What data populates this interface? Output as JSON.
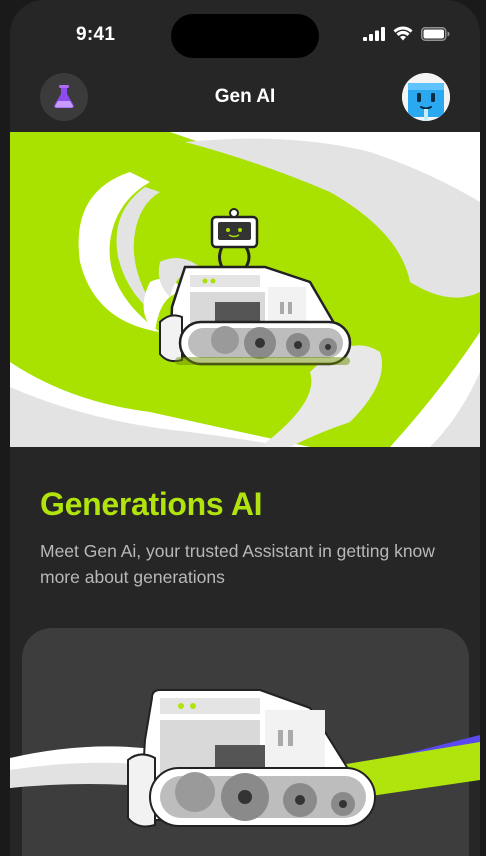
{
  "status_bar": {
    "time": "9:41",
    "icons": [
      "cellular-signal-icon",
      "wifi-icon",
      "battery-icon"
    ]
  },
  "nav": {
    "title": "Gen AI",
    "left_icon": "flask-icon",
    "right_avatar": "robot-avatar"
  },
  "hero": {
    "illustration": "robot-bulldozer-illustration"
  },
  "content": {
    "heading": "Generations AI",
    "description": "Meet Gen Ai, your trusted Assistant in getting know more about generations"
  },
  "card": {
    "illustration": "bulldozer-illustration"
  },
  "colors": {
    "accent": "#b0e40c",
    "hero_bg": "#a9e100",
    "screen_bg": "#262626",
    "card_bg": "#3d3d3d",
    "stripe_purple": "#5a4af0"
  }
}
